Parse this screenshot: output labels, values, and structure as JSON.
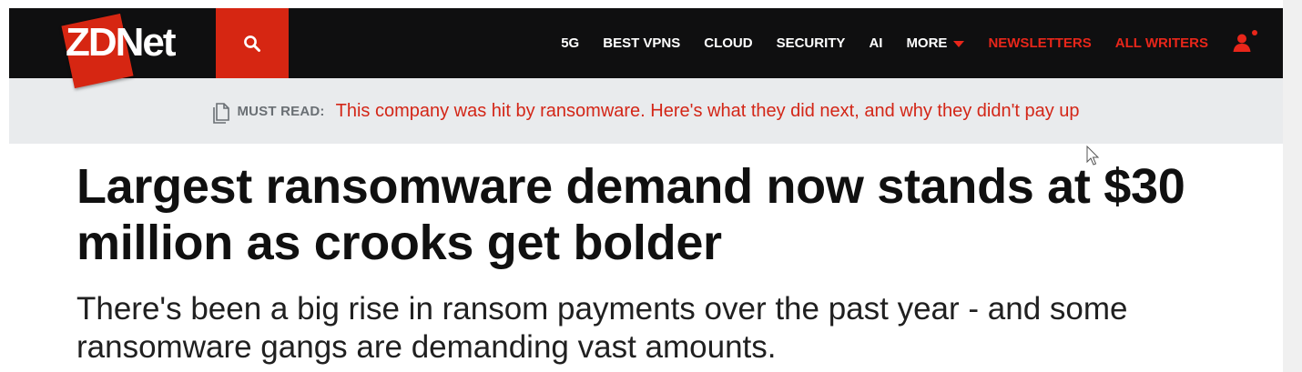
{
  "brand": {
    "logo_text": "ZDNet",
    "accent_color": "#d62612"
  },
  "nav": {
    "items": [
      {
        "label": "5G"
      },
      {
        "label": "Best VPNs"
      },
      {
        "label": "Cloud"
      },
      {
        "label": "Security"
      },
      {
        "label": "AI"
      },
      {
        "label": "More"
      }
    ],
    "newsletters_label": "Newsletters",
    "all_writers_label": "All Writers",
    "search_icon": "search-icon",
    "user_icon": "user-icon"
  },
  "must_read": {
    "label": "Must read:",
    "link_text": "This company was hit by ransomware. Here's what they did next, and why they didn't pay up",
    "icon": "document-icon"
  },
  "article": {
    "headline": "Largest ransomware demand now stands at $30 million as crooks get bolder",
    "subheadline": "There's been a big rise in ransom payments over the past year - and some ransomware gangs are demanding vast amounts."
  }
}
